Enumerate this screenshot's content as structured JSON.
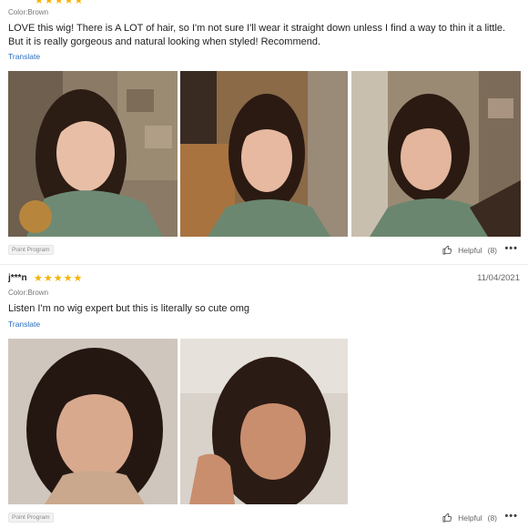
{
  "review1": {
    "color": "Color:Brown",
    "text": "LOVE this wig! There is A LOT of hair, so I'm not sure I'll wear it straight down unless I find a way to thin it a little. But it is really gorgeous and natural looking when styled! Recommend.",
    "translate": "Translate",
    "badge": "Point Program",
    "helpful": "Helpful",
    "helpful_count": "(8)",
    "more": "•••"
  },
  "review2": {
    "user": "j***n",
    "stars": "★★★★★",
    "date": "11/04/2021",
    "color": "Color:Brown",
    "text": "Listen I'm no wig expert but this is literally so cute omg",
    "translate": "Translate",
    "badge": "Point Program",
    "helpful": "Helpful",
    "helpful_count": "(8)",
    "more": "•••"
  },
  "colors": {
    "star": "#f5b301",
    "link": "#2a6ebd"
  }
}
